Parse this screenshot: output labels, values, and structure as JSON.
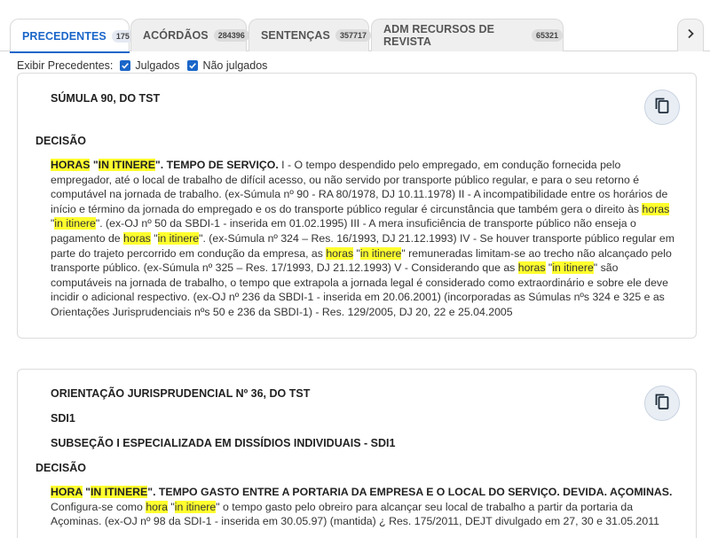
{
  "tabs": [
    {
      "label": "PRECEDENTES",
      "count": "175",
      "active": true
    },
    {
      "label": "ACÓRDÃOS",
      "count": "284396",
      "active": false
    },
    {
      "label": "SENTENÇAS",
      "count": "357717",
      "active": false
    },
    {
      "label": "ADM RECURSOS DE REVISTA",
      "count": "65321",
      "active": false
    }
  ],
  "tab_next_icon": "chevron-right-icon",
  "filter": {
    "label": "Exibir Precedentes:",
    "options": [
      {
        "label": "Julgados",
        "checked": true
      },
      {
        "label": "Não julgados",
        "checked": true
      }
    ]
  },
  "colors": {
    "accent": "#1a66c9",
    "highlight": "#ffff2e"
  },
  "cards": [
    {
      "title": "SÚMULA 90, DO TST",
      "decision_label": "DECISÃO",
      "copy_icon": "copy-icon"
    },
    {
      "title": "ORIENTAÇÃO JURISPRUDENCIAL Nº 36, DO TST",
      "subtitle": "SDI1",
      "subtitle2": "SUBSEÇÃO I ESPECIALIZADA EM DISSÍDIOS INDIVIDUAIS - SDI1",
      "decision_label": "DECISÃO",
      "copy_icon": "copy-icon"
    }
  ],
  "card1_text": {
    "s1": "HORAS",
    "s2": " \"",
    "s3": "IN ITINERE",
    "s4": "\". TEMPO DE SERVIÇO.",
    "s5": " I - O tempo despendido pelo empregado, em condução fornecida pelo empregador, até o local de trabalho de difícil acesso, ou não servido por transporte público regular, e para o seu retorno é computável na jornada de trabalho. (ex-Súmula nº 90 - RA 80/1978, DJ 10.11.1978) II - A incompatibilidade entre os horários de início e término da jornada do empregado e os do transporte público regular é circunstância que também gera o direito às ",
    "s6": "horas",
    "s7": " \"",
    "s8": "in itinere",
    "s9": "\". (ex-OJ nº 50 da SBDI-1 - inserida em 01.02.1995) III - A mera insuficiência de transporte público não enseja o pagamento de ",
    "s10": "horas",
    "s11": " \"",
    "s12": "in itinere",
    "s13": "\". (ex-Súmula nº 324 – Res. 16/1993, DJ 21.12.1993) IV - Se houver transporte público regular em parte do trajeto percorrido em condução da empresa, as ",
    "s14": "horas",
    "s15": " \"",
    "s16": "in itinere",
    "s17": "\" remuneradas limitam-se ao trecho não alcançado pelo transporte público. (ex-Súmula nº 325 – Res. 17/1993, DJ 21.12.1993) V - Considerando que as ",
    "s18": "horas",
    "s19": " \"",
    "s20": "in itinere",
    "s21": "\" são computáveis na jornada de trabalho, o tempo que extrapola a jornada legal é considerado como extraordinário e sobre ele deve incidir o adicional respectivo. (ex-OJ nº 236 da SBDI-1 - inserida em 20.06.2001) (incorporadas as Súmulas nºs 324 e 325 e as Orientações Jurisprudenciais nºs 50 e 236 da SBDI-1) - Res. 129/2005, DJ 20, 22 e 25.04.2005"
  },
  "card2_text": {
    "s1": "HORA",
    "s2": " \"",
    "s3": "IN ITINERE",
    "s4": "\". TEMPO GASTO ENTRE A PORTARIA DA EMPRESA E O LOCAL DO SERVIÇO. DEVIDA. AÇOMINAS.",
    "s5": " Configura-se como ",
    "s6": "hora",
    "s7": " \"",
    "s8": "in itinere",
    "s9": "\" o tempo gasto pelo obreiro para alcançar seu local de trabalho a partir da portaria da Açominas. (ex-OJ nº 98 da SDI-1 - inserida em 30.05.97) (mantida) ¿ Res. 175/2011, DEJT divulgado em 27, 30 e 31.05.2011"
  }
}
